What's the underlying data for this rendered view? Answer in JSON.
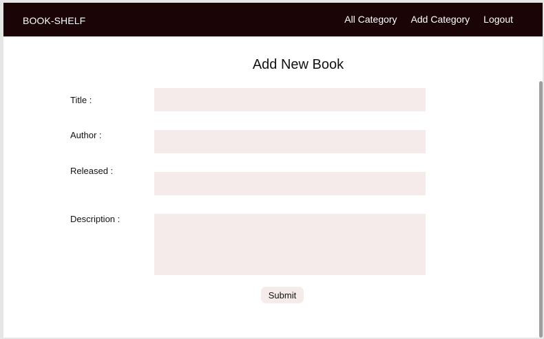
{
  "navbar": {
    "brand": "BOOK-SHELF",
    "links": [
      {
        "label": "All Category"
      },
      {
        "label": "Add Category"
      },
      {
        "label": "Logout"
      }
    ]
  },
  "form": {
    "title": "Add New Book",
    "fields": {
      "title": {
        "label": "Title :",
        "value": ""
      },
      "author": {
        "label": "Author :",
        "value": ""
      },
      "released": {
        "label": "Released :",
        "value": ""
      },
      "description": {
        "label": "Description :",
        "value": ""
      }
    },
    "submit_label": "Submit"
  },
  "colors": {
    "navbar_bg": "#1a0406",
    "field_bg": "#f5ebea"
  }
}
